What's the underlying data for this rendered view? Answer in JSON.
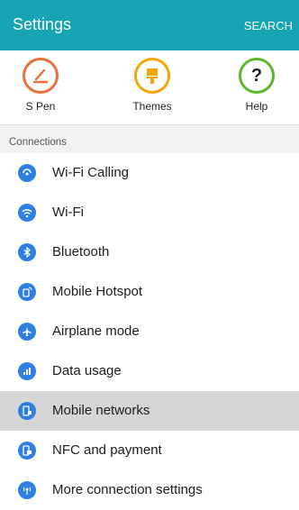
{
  "header": {
    "title": "Settings",
    "search_label": "SEARCH"
  },
  "quick_settings": [
    {
      "label": "S Pen",
      "icon": "pen-icon",
      "color": "#e8703a"
    },
    {
      "label": "Themes",
      "icon": "brush-icon",
      "color": "#f2a60a"
    },
    {
      "label": "Help",
      "icon": "help-icon",
      "color": "#5cb72a"
    }
  ],
  "section": {
    "title": "Connections"
  },
  "items": [
    {
      "label": "Wi-Fi Calling",
      "icon": "wifi-calling-icon"
    },
    {
      "label": "Wi-Fi",
      "icon": "wifi-icon"
    },
    {
      "label": "Bluetooth",
      "icon": "bluetooth-icon"
    },
    {
      "label": "Mobile Hotspot",
      "icon": "hotspot-icon"
    },
    {
      "label": "Airplane mode",
      "icon": "airplane-icon"
    },
    {
      "label": "Data usage",
      "icon": "data-usage-icon"
    },
    {
      "label": "Mobile networks",
      "icon": "mobile-networks-icon",
      "selected": true
    },
    {
      "label": "NFC and payment",
      "icon": "nfc-icon"
    },
    {
      "label": "More connection settings",
      "icon": "more-connections-icon"
    }
  ],
  "colors": {
    "accent": "#14a4b4",
    "icon_blue": "#2e7fe0",
    "selected_row": "#d6d6d6"
  }
}
